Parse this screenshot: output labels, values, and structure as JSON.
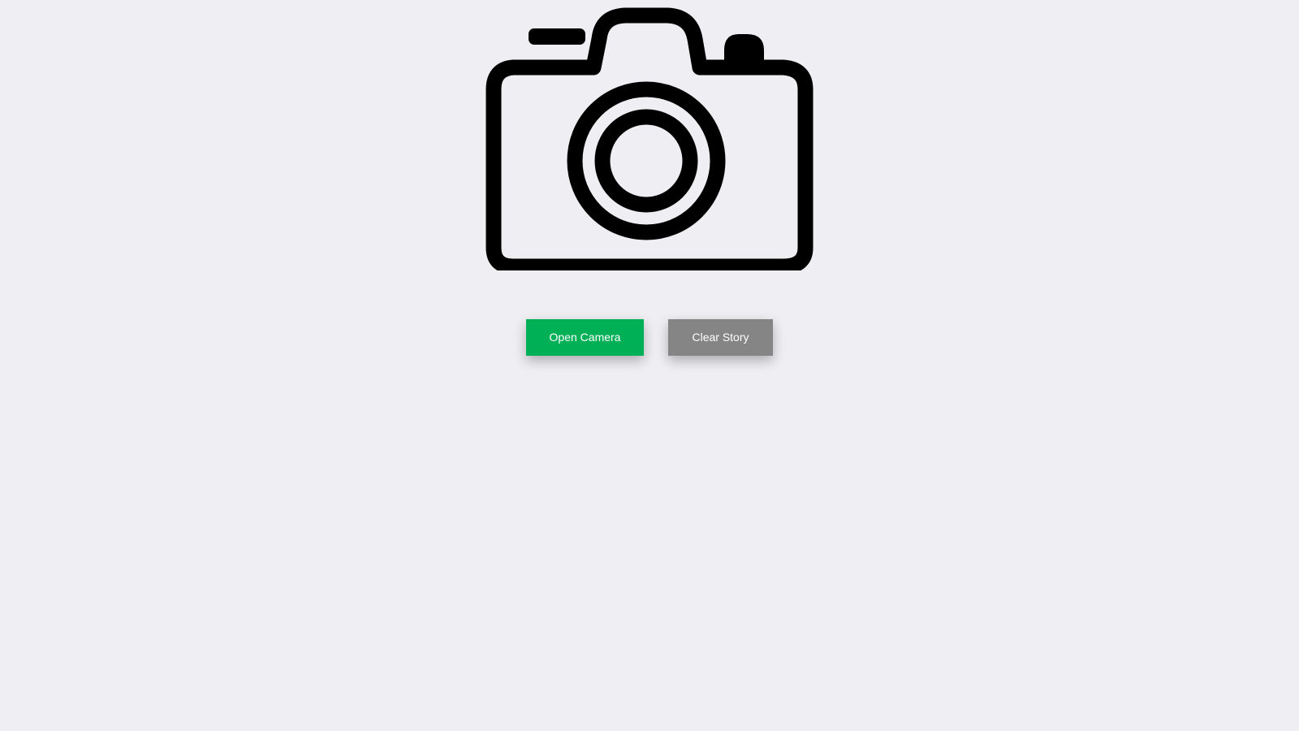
{
  "camera": {
    "icon": "camera-icon"
  },
  "actions": {
    "open_camera_label": "Open Camera",
    "clear_story_label": "Clear Story"
  },
  "colors": {
    "background": "#efeff3",
    "open_camera_button": "#00b057",
    "clear_story_button": "#858585",
    "icon_stroke": "#000000"
  }
}
